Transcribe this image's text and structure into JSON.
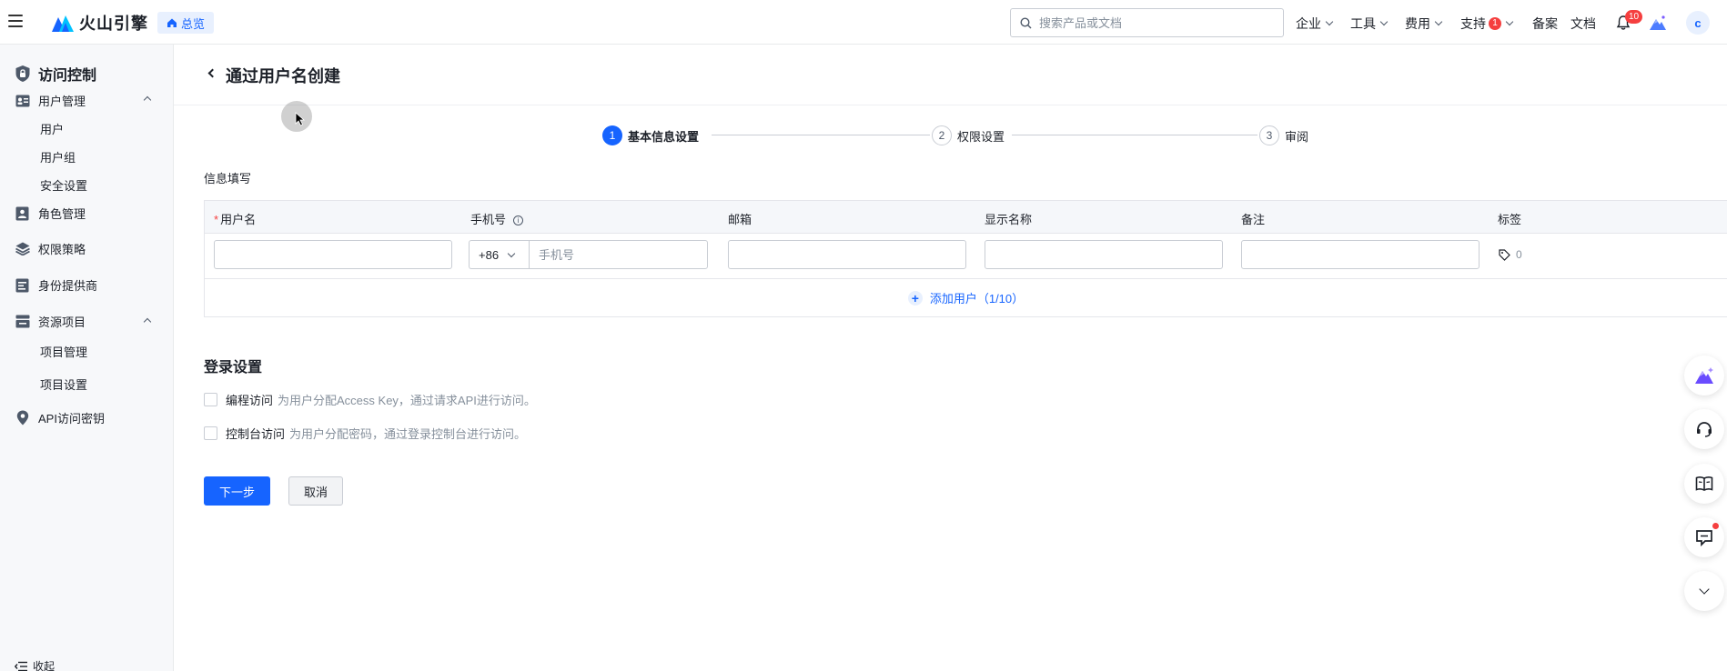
{
  "topbar": {
    "brand": "火山引擎",
    "overview": "总览",
    "search_placeholder": "搜索产品或文档",
    "nav": [
      {
        "label": "企业"
      },
      {
        "label": "工具"
      },
      {
        "label": "费用"
      },
      {
        "label": "支持",
        "badge": "1"
      },
      {
        "label": "备案"
      },
      {
        "label": "文档"
      }
    ],
    "bell_badge": "10",
    "avatar": "c"
  },
  "sidebar": {
    "title": "访问控制",
    "items": {
      "user_mgmt": "用户管理",
      "users": "用户",
      "user_groups": "用户组",
      "security": "安全设置",
      "roles": "角色管理",
      "policies": "权限策略",
      "idp": "身份提供商",
      "resources": "资源项目",
      "project_mgmt": "项目管理",
      "project_settings": "项目设置",
      "api_keys": "API访问密钥"
    },
    "collapse": "收起"
  },
  "page": {
    "title": "通过用户名创建",
    "steps": [
      {
        "num": "1",
        "label": "基本信息设置"
      },
      {
        "num": "2",
        "label": "权限设置"
      },
      {
        "num": "3",
        "label": "审阅"
      }
    ],
    "section_label": "信息填写",
    "table": {
      "headers": {
        "username": "用户名",
        "phone": "手机号",
        "email": "邮箱",
        "display_name": "显示名称",
        "note": "备注",
        "tags": "标签"
      },
      "country_code": "+86",
      "phone_placeholder": "手机号",
      "tag_count": "0",
      "add_user": "添加用户（1/10）"
    },
    "login": {
      "title": "登录设置",
      "programmatic": {
        "label": "编程访问",
        "desc": "为用户分配Access Key，通过请求API进行访问。"
      },
      "console": {
        "label": "控制台访问",
        "desc": "为用户分配密码，通过登录控制台进行访问。"
      }
    },
    "next": "下一步",
    "cancel": "取消"
  },
  "colors": {
    "primary": "#1664ff",
    "danger": "#f53f3f",
    "sidebar_bg": "#f7f8fa"
  }
}
